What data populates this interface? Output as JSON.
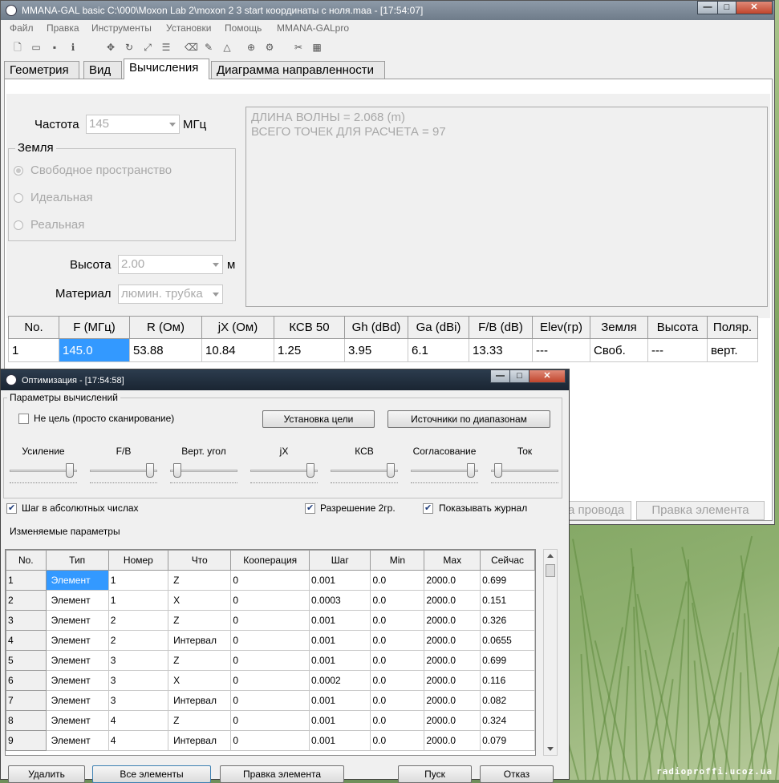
{
  "main": {
    "title": "MMANA-GAL basic C:\\000\\Moxon Lab 2\\moxon 2 3 start координаты с ноля.maa - [17:54:07]",
    "menu": [
      "Файл",
      "Правка",
      "Инструменты",
      "Установки",
      "Помощь",
      "MMANA-GALpro"
    ],
    "tabs": [
      "Геометрия",
      "Вид",
      "Вычисления",
      "Диаграмма направленности"
    ],
    "active_tab": "Вычисления",
    "frequency_label": "Частота",
    "frequency_value": "145",
    "frequency_unit": "МГц",
    "ground_group": "Земля",
    "ground_options": [
      "Свободное пространство",
      "Идеальная",
      "Реальная"
    ],
    "height_label": "Высота",
    "height_value": "2.00",
    "height_unit": "м",
    "material_label": "Материал",
    "material_value": "люмин. трубка",
    "log": [
      "ДЛИНА ВОЛНЫ = 2.068 (m)",
      "ВСЕГО ТОЧЕК ДЛЯ РАСЧЕТА = 97"
    ],
    "results_headers": [
      "No.",
      "F (МГц)",
      "R (Ом)",
      "jX (Ом)",
      "КСВ 50",
      "Gh (dBd)",
      "Ga (dBi)",
      "F/B (dB)",
      "Elev(гр)",
      "Земля",
      "Высота",
      "Поляр."
    ],
    "results_row": [
      "1",
      "145.0",
      "53.88",
      "10.84",
      "1.25",
      "3.95",
      "6.1",
      "13.33",
      "---",
      "Своб.",
      "---",
      "верт."
    ],
    "bg_button_wire": "а провода",
    "bg_button_edit": "Правка элемента"
  },
  "opt": {
    "title": "Оптимизация - [17:54:58]",
    "params_group": "Параметры вычислений",
    "no_target_label": "Не цель (просто сканирование)",
    "set_target_button": "Установка цели",
    "sources_button": "Источники по диапазонам",
    "sliders": [
      {
        "label": "Усиление",
        "value": 0.95
      },
      {
        "label": "F/B",
        "value": 0.95
      },
      {
        "label": "Верт. угол",
        "value": 0.05
      },
      {
        "label": "jX",
        "value": 0.95
      },
      {
        "label": "КСВ",
        "value": 0.95
      },
      {
        "label": "Согласование",
        "value": 0.95
      },
      {
        "label": "Ток",
        "value": 0.05
      }
    ],
    "abs_step_label": "Шаг в абсолютных числах",
    "resolution_label": "Разрешение 2гр.",
    "show_log_label": "Показывать журнал",
    "params_label": "Изменяемые параметры",
    "grid_headers": [
      "No.",
      "Тип",
      "Номер",
      "Что",
      "Кооперация",
      "Шаг",
      "Min",
      "Max",
      "Сейчас"
    ],
    "grid_rows": [
      [
        "1",
        "Элемент",
        "1",
        "Z",
        "0",
        "0.001",
        "0.0",
        "2000.0",
        "0.699"
      ],
      [
        "2",
        "Элемент",
        "1",
        "X",
        "0",
        "0.0003",
        "0.0",
        "2000.0",
        "0.151"
      ],
      [
        "3",
        "Элемент",
        "2",
        "Z",
        "0",
        "0.001",
        "0.0",
        "2000.0",
        "0.326"
      ],
      [
        "4",
        "Элемент",
        "2",
        "Интервал",
        "0",
        "0.001",
        "0.0",
        "2000.0",
        "0.0655"
      ],
      [
        "5",
        "Элемент",
        "3",
        "Z",
        "0",
        "0.001",
        "0.0",
        "2000.0",
        "0.699"
      ],
      [
        "6",
        "Элемент",
        "3",
        "X",
        "0",
        "0.0002",
        "0.0",
        "2000.0",
        "0.116"
      ],
      [
        "7",
        "Элемент",
        "3",
        "Интервал",
        "0",
        "0.001",
        "0.0",
        "2000.0",
        "0.082"
      ],
      [
        "8",
        "Элемент",
        "4",
        "Z",
        "0",
        "0.001",
        "0.0",
        "2000.0",
        "0.324"
      ],
      [
        "9",
        "Элемент",
        "4",
        "Интервал",
        "0",
        "0.001",
        "0.0",
        "2000.0",
        "0.079"
      ]
    ],
    "buttons": [
      "Удалить",
      "Все элементы",
      "Правка элемента",
      "Пуск",
      "Отказ"
    ]
  },
  "watermark": "radioproffi.ucoz.ua"
}
